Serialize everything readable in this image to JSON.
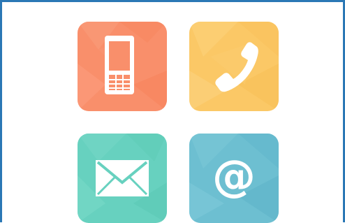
{
  "icons": [
    {
      "name": "mobile-phone-icon",
      "color": "#f98f6b"
    },
    {
      "name": "telephone-handset-icon",
      "color": "#fbc866"
    },
    {
      "name": "envelope-icon",
      "color": "#67d1bf"
    },
    {
      "name": "at-sign-icon",
      "color": "#6dbfd1",
      "symbol": "@"
    }
  ],
  "frame_color": "#2b78b5"
}
